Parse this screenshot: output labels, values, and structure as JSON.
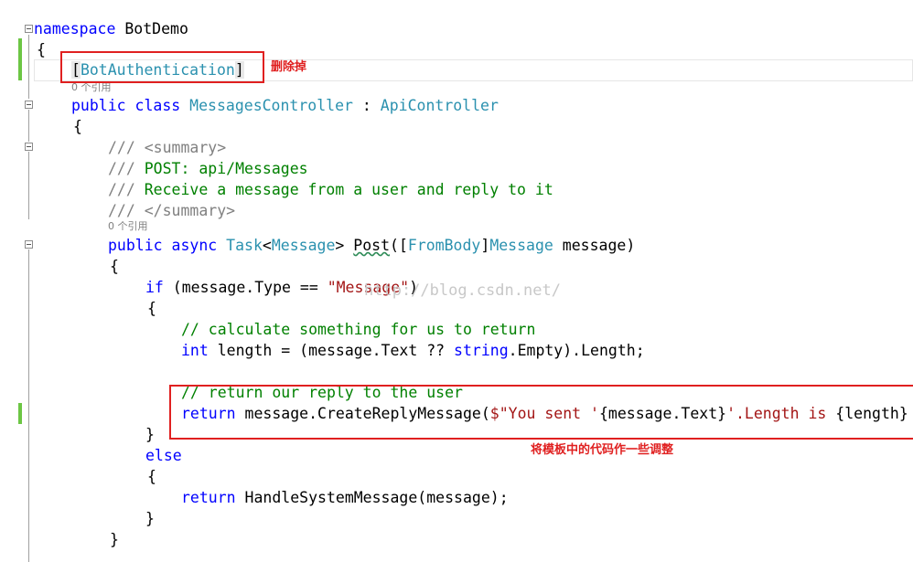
{
  "editor": {
    "lines": {
      "l1_kw": "namespace",
      "l1_name": " BotDemo",
      "l2": "{",
      "l3_open": "[",
      "l3_attr": "BotAuthentication",
      "l3_close": "]",
      "l4_kw1": "public",
      "l4_kw2": "class",
      "l4_cls": "MessagesController",
      "l4_sep": " : ",
      "l4_base": "ApiController",
      "l5": "{",
      "l6_slashes": "///",
      "l6_tag": " <summary>",
      "l7_slashes": "///",
      "l7_text": " POST: api/Messages",
      "l8_slashes": "///",
      "l8_text": " Receive a message from a user and reply to it",
      "l9_slashes": "///",
      "l9_tag": " </summary>",
      "l10_kw1": "public",
      "l10_kw2": "async",
      "l10_task": "Task",
      "l10_lt": "<",
      "l10_msg": "Message",
      "l10_gt": "> ",
      "l10_method": "Post",
      "l10_paren": "([",
      "l10_attr": "FromBody",
      "l10_br": "]",
      "l10_ptype": "Message",
      "l10_rest": " message)",
      "l11": "{",
      "l12_kw": "if",
      "l12_cond": " (message.Type == ",
      "l12_str": "\"Message\"",
      "l12_end": ")",
      "l13": "{",
      "l14_cm": "// calculate something for us to return",
      "l15_kw": "int",
      "l15_mid": " length = (message.Text ?? ",
      "l15_kw2": "string",
      "l15_end": ".Empty).Length;",
      "l16_cm": "// return our reply to the user",
      "l17_kw": "return",
      "l17_mid": " message.CreateReplyMessage(",
      "l17_str1": "$\"You sent '",
      "l17_interp1": "{message.Text}",
      "l17_str2": "'.Length is ",
      "l17_interp2": "{length}",
      "l18": "}",
      "l19_kw": "else",
      "l20": "{",
      "l21_kw": "return",
      "l21_rest": " HandleSystemMessage(message);",
      "l22": "}",
      "l23": "}"
    },
    "references": {
      "class_refs": "0 个引用",
      "method_refs": "0 个引用"
    }
  },
  "annotations": {
    "remove_label": "删除掉",
    "adjust_label": "将模板中的代码作一些调整"
  },
  "watermark": "http://blog.csdn.net/",
  "colors": {
    "keyword": "#0000ff",
    "type": "#2b91af",
    "comment": "#008000",
    "string": "#a31515",
    "annotation": "#e02020",
    "change_bar": "#6cc644"
  }
}
